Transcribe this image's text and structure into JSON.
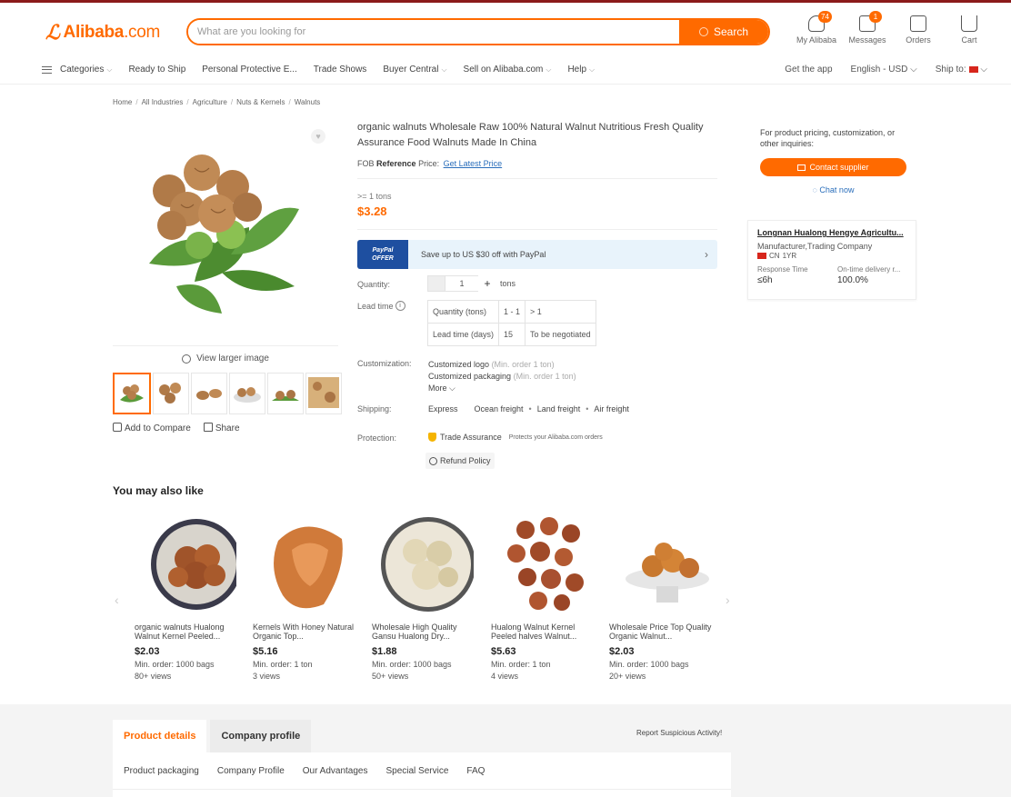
{
  "header": {
    "logo_brand": "Alibaba",
    "logo_domain": ".com",
    "search_placeholder": "What are you looking for",
    "search_button": "Search",
    "icons": [
      {
        "label": "My Alibaba",
        "badge": "74",
        "icon": "person-icon"
      },
      {
        "label": "Messages",
        "badge": "1",
        "icon": "message-icon"
      },
      {
        "label": "Orders",
        "badge": "",
        "icon": "orders-icon"
      },
      {
        "label": "Cart",
        "badge": "",
        "icon": "cart-icon"
      }
    ]
  },
  "nav": {
    "categories": "Categories",
    "items": [
      "Ready to Ship",
      "Personal Protective E...",
      "Trade Shows",
      "Buyer Central",
      "Sell on Alibaba.com",
      "Help"
    ],
    "get_app": "Get the app",
    "language": "English - USD",
    "ship_to": "Ship to:"
  },
  "breadcrumb": [
    "Home",
    "All Industries",
    "Agriculture",
    "Nuts & Kernels",
    "Walnuts"
  ],
  "gallery": {
    "view_larger": "View larger image",
    "add_to_compare": "Add to Compare",
    "share": "Share"
  },
  "product": {
    "title": "organic walnuts Wholesale Raw 100% Natural Walnut Nutritious Fresh Quality Assurance Food Walnuts Made In China",
    "fob_prefix": "FOB",
    "fob_reference": "Reference",
    "fob_price_label": "Price:",
    "fob_link": "Get Latest Price",
    "moq": ">= 1 tons",
    "price": "$3.28",
    "paypal_badge_line1": "PayPal",
    "paypal_badge_line2": "OFFER",
    "paypal_text": "Save up to US $30 off with PayPal",
    "quantity_label": "Quantity:",
    "quantity_value": "1",
    "quantity_unit": "tons",
    "lead_time_label": "Lead time",
    "lead_table": {
      "row1": [
        "Quantity (tons)",
        "1 - 1",
        "> 1"
      ],
      "row2": [
        "Lead time (days)",
        "15",
        "To be negotiated"
      ]
    },
    "customization_label": "Customization:",
    "customization": [
      {
        "name": "Customized logo",
        "note": "(Min. order 1 ton)"
      },
      {
        "name": "Customized packaging",
        "note": "(Min. order 1 ton)"
      }
    ],
    "more": "More",
    "shipping_label": "Shipping:",
    "shipping": [
      "Express",
      "Ocean freight",
      "Land freight",
      "Air freight"
    ],
    "protection_label": "Protection:",
    "trade_assurance": "Trade Assurance",
    "trade_assurance_note": "Protects your Alibaba.com orders",
    "refund_policy": "Refund Policy"
  },
  "sidebar": {
    "prompt": "For product pricing, customization, or other inquiries:",
    "contact_button": "Contact supplier",
    "chat_now": "Chat now",
    "supplier_name": "Longnan Hualong Hengye Agricultu...",
    "supplier_type": "Manufacturer,Trading Company",
    "country": "CN",
    "years": "1YR",
    "response_label": "Response Time",
    "response_value": "≤6h",
    "delivery_label": "On-time delivery r...",
    "delivery_value": "100.0%"
  },
  "recommendations": {
    "title": "You may also like",
    "items": [
      {
        "name": "organic walnuts Hualong Walnut Kernel Peeled...",
        "price": "$2.03",
        "moq": "Min. order: 1000 bags",
        "views": "80+ views"
      },
      {
        "name": "Kernels With Honey Natural Organic Top...",
        "price": "$5.16",
        "moq": "Min. order: 1 ton",
        "views": "3 views"
      },
      {
        "name": "Wholesale High Quality Gansu Hualong Dry...",
        "price": "$1.88",
        "moq": "Min. order: 1000 bags",
        "views": "50+ views"
      },
      {
        "name": "Hualong Walnut Kernel Peeled halves Walnut...",
        "price": "$5.63",
        "moq": "Min. order: 1 ton",
        "views": "4 views"
      },
      {
        "name": "Wholesale Price Top Quality Organic Walnut...",
        "price": "$2.03",
        "moq": "Min. order: 1000 bags",
        "views": "20+ views"
      }
    ]
  },
  "bottom": {
    "tabs": [
      "Product details",
      "Company profile"
    ],
    "report": "Report Suspicious Activity!",
    "subnav": [
      "Product packaging",
      "Company Profile",
      "Our Advantages",
      "Special Service",
      "FAQ"
    ]
  },
  "colors": {
    "accent": "#ff6a00",
    "link": "#2a6ebb",
    "paypal_blue": "#1e4fa0"
  }
}
